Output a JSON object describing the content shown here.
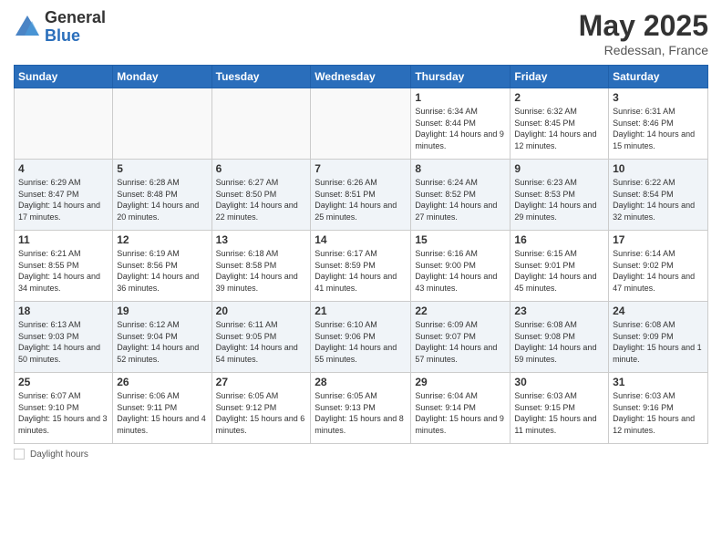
{
  "header": {
    "logo_general": "General",
    "logo_blue": "Blue",
    "month_title": "May 2025",
    "location": "Redessan, France"
  },
  "calendar": {
    "days_of_week": [
      "Sunday",
      "Monday",
      "Tuesday",
      "Wednesday",
      "Thursday",
      "Friday",
      "Saturday"
    ],
    "weeks": [
      {
        "cells": [
          {
            "day": "",
            "info": ""
          },
          {
            "day": "",
            "info": ""
          },
          {
            "day": "",
            "info": ""
          },
          {
            "day": "",
            "info": ""
          },
          {
            "day": "1",
            "info": "Sunrise: 6:34 AM\nSunset: 8:44 PM\nDaylight: 14 hours\nand 9 minutes."
          },
          {
            "day": "2",
            "info": "Sunrise: 6:32 AM\nSunset: 8:45 PM\nDaylight: 14 hours\nand 12 minutes."
          },
          {
            "day": "3",
            "info": "Sunrise: 6:31 AM\nSunset: 8:46 PM\nDaylight: 14 hours\nand 15 minutes."
          }
        ]
      },
      {
        "cells": [
          {
            "day": "4",
            "info": "Sunrise: 6:29 AM\nSunset: 8:47 PM\nDaylight: 14 hours\nand 17 minutes."
          },
          {
            "day": "5",
            "info": "Sunrise: 6:28 AM\nSunset: 8:48 PM\nDaylight: 14 hours\nand 20 minutes."
          },
          {
            "day": "6",
            "info": "Sunrise: 6:27 AM\nSunset: 8:50 PM\nDaylight: 14 hours\nand 22 minutes."
          },
          {
            "day": "7",
            "info": "Sunrise: 6:26 AM\nSunset: 8:51 PM\nDaylight: 14 hours\nand 25 minutes."
          },
          {
            "day": "8",
            "info": "Sunrise: 6:24 AM\nSunset: 8:52 PM\nDaylight: 14 hours\nand 27 minutes."
          },
          {
            "day": "9",
            "info": "Sunrise: 6:23 AM\nSunset: 8:53 PM\nDaylight: 14 hours\nand 29 minutes."
          },
          {
            "day": "10",
            "info": "Sunrise: 6:22 AM\nSunset: 8:54 PM\nDaylight: 14 hours\nand 32 minutes."
          }
        ]
      },
      {
        "cells": [
          {
            "day": "11",
            "info": "Sunrise: 6:21 AM\nSunset: 8:55 PM\nDaylight: 14 hours\nand 34 minutes."
          },
          {
            "day": "12",
            "info": "Sunrise: 6:19 AM\nSunset: 8:56 PM\nDaylight: 14 hours\nand 36 minutes."
          },
          {
            "day": "13",
            "info": "Sunrise: 6:18 AM\nSunset: 8:58 PM\nDaylight: 14 hours\nand 39 minutes."
          },
          {
            "day": "14",
            "info": "Sunrise: 6:17 AM\nSunset: 8:59 PM\nDaylight: 14 hours\nand 41 minutes."
          },
          {
            "day": "15",
            "info": "Sunrise: 6:16 AM\nSunset: 9:00 PM\nDaylight: 14 hours\nand 43 minutes."
          },
          {
            "day": "16",
            "info": "Sunrise: 6:15 AM\nSunset: 9:01 PM\nDaylight: 14 hours\nand 45 minutes."
          },
          {
            "day": "17",
            "info": "Sunrise: 6:14 AM\nSunset: 9:02 PM\nDaylight: 14 hours\nand 47 minutes."
          }
        ]
      },
      {
        "cells": [
          {
            "day": "18",
            "info": "Sunrise: 6:13 AM\nSunset: 9:03 PM\nDaylight: 14 hours\nand 50 minutes."
          },
          {
            "day": "19",
            "info": "Sunrise: 6:12 AM\nSunset: 9:04 PM\nDaylight: 14 hours\nand 52 minutes."
          },
          {
            "day": "20",
            "info": "Sunrise: 6:11 AM\nSunset: 9:05 PM\nDaylight: 14 hours\nand 54 minutes."
          },
          {
            "day": "21",
            "info": "Sunrise: 6:10 AM\nSunset: 9:06 PM\nDaylight: 14 hours\nand 55 minutes."
          },
          {
            "day": "22",
            "info": "Sunrise: 6:09 AM\nSunset: 9:07 PM\nDaylight: 14 hours\nand 57 minutes."
          },
          {
            "day": "23",
            "info": "Sunrise: 6:08 AM\nSunset: 9:08 PM\nDaylight: 14 hours\nand 59 minutes."
          },
          {
            "day": "24",
            "info": "Sunrise: 6:08 AM\nSunset: 9:09 PM\nDaylight: 15 hours\nand 1 minute."
          }
        ]
      },
      {
        "cells": [
          {
            "day": "25",
            "info": "Sunrise: 6:07 AM\nSunset: 9:10 PM\nDaylight: 15 hours\nand 3 minutes."
          },
          {
            "day": "26",
            "info": "Sunrise: 6:06 AM\nSunset: 9:11 PM\nDaylight: 15 hours\nand 4 minutes."
          },
          {
            "day": "27",
            "info": "Sunrise: 6:05 AM\nSunset: 9:12 PM\nDaylight: 15 hours\nand 6 minutes."
          },
          {
            "day": "28",
            "info": "Sunrise: 6:05 AM\nSunset: 9:13 PM\nDaylight: 15 hours\nand 8 minutes."
          },
          {
            "day": "29",
            "info": "Sunrise: 6:04 AM\nSunset: 9:14 PM\nDaylight: 15 hours\nand 9 minutes."
          },
          {
            "day": "30",
            "info": "Sunrise: 6:03 AM\nSunset: 9:15 PM\nDaylight: 15 hours\nand 11 minutes."
          },
          {
            "day": "31",
            "info": "Sunrise: 6:03 AM\nSunset: 9:16 PM\nDaylight: 15 hours\nand 12 minutes."
          }
        ]
      }
    ]
  },
  "footer": {
    "daylight_label": "Daylight hours"
  }
}
